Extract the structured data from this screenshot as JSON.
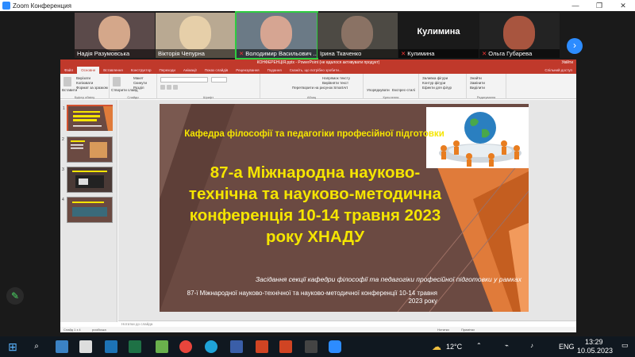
{
  "zoom": {
    "title": "Zoom Конференция",
    "window_buttons": [
      "—",
      "❐",
      "✕"
    ]
  },
  "participants": [
    {
      "name": "Надія Разумовська",
      "muted": false,
      "kind": "video"
    },
    {
      "name": "Вікторія Чепурна",
      "muted": false,
      "kind": "video"
    },
    {
      "name": "Володимир Васильович ...",
      "muted": true,
      "kind": "video",
      "active": true
    },
    {
      "name": "Ірина Ткаченко",
      "muted": false,
      "kind": "video"
    },
    {
      "name": "Кулимина",
      "muted": true,
      "kind": "name-only",
      "big_name": "Кулимина"
    },
    {
      "name": "Ольга Губарева",
      "muted": true,
      "kind": "video"
    }
  ],
  "powerpoint": {
    "title": "КОНФЕРЕНЦІЯ.pptx - PowerPoint (не вдалося активувати продукт)",
    "title_right": "Увійти",
    "tabs": [
      "Файл",
      "Основне",
      "Вставлення",
      "Конструктор",
      "Переходи",
      "Анімації",
      "Показ слайдів",
      "Рецензування",
      "Подання",
      "Скажіть, що потрібно зробити..."
    ],
    "selected_tab": "Основне",
    "share_label": "Спільний доступ",
    "ribbon_groups": [
      {
        "label": "Буфер обміну",
        "items": [
          "Вставити",
          "Вирізати",
          "Копіювати",
          "Формат за зразком"
        ]
      },
      {
        "label": "Слайди",
        "items": [
          "Створити слайд",
          "Макет",
          "Скинути",
          "Розділ"
        ]
      },
      {
        "label": "Шрифт",
        "items": []
      },
      {
        "label": "Абзац",
        "items": [
          "Напрямок тексту",
          "Вирівняти текст",
          "Перетворити на рисунок SmartArt"
        ]
      },
      {
        "label": "Креслення",
        "items": [
          "Упорядкувати",
          "Експрес-стилі"
        ]
      },
      {
        "label": "",
        "items": [
          "Заливка фігури",
          "Контур фігури",
          "Ефекти для фігур"
        ]
      },
      {
        "label": "Редагування",
        "items": [
          "Знайти",
          "Замінити",
          "Виділити"
        ]
      }
    ],
    "slide_numbers": [
      "1",
      "2",
      "3",
      "4"
    ],
    "slide": {
      "subtitle": "Кафедра філософії та педагогіки професійної підготовки",
      "title": "87-а Міжнародна науково-технічна та науково-методична конференція 10-14 травня 2023 року ХНАДУ",
      "section": "Засідання секції кафедри філософії та педагогіки професійної підготовки у рамках",
      "conference": "87-ї Міжнародної науково-технічної та науково-методичної конференції 10-14 травня 2023 року"
    },
    "notes_placeholder": "Нотатки до слайда",
    "status": {
      "slide_counter": "Слайд 1 з 4",
      "language": "російська",
      "notes": "Нотатки",
      "comments": "Примітки"
    }
  },
  "taskbar": {
    "weather": "12°C",
    "language": "ENG",
    "time": "13:29",
    "date": "10.05.2023"
  },
  "colors": {
    "ppt_accent": "#c0392b",
    "zoom_accent": "#2d8cff",
    "slide_text": "#f5e500",
    "slide_bg": "#6b4a42",
    "active_speaker": "#2ecc40"
  }
}
